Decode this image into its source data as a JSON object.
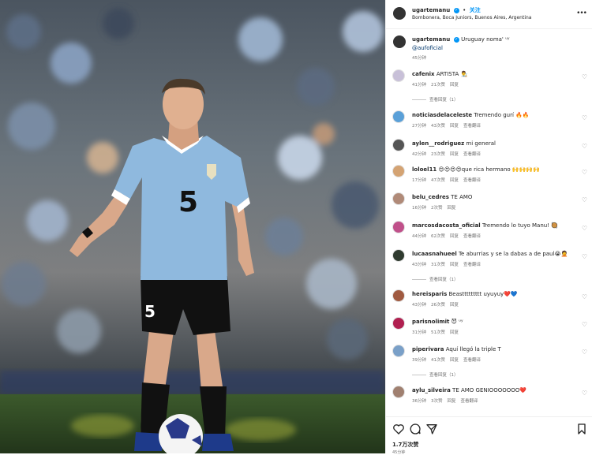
{
  "post": {
    "username": "ugartemanu",
    "follow_label": "关注",
    "location": "Bombonera, Boca Juniors, Buenos Aires, Argentina",
    "caption_text": "Uruguay noma' ᵘʸ",
    "caption_mention": "@aufoficial",
    "caption_time": "45分钟",
    "likes": "1.7万次赞",
    "post_time": "45分钟"
  },
  "player": {
    "jersey_number": "5"
  },
  "comments": [
    {
      "user": "cafenix",
      "text": "ARTISTA 👨‍🎨",
      "time": "41分钟",
      "likes": "21次赞",
      "reply": "回复",
      "translate": "",
      "replies": "查看回复（1）",
      "av_color": "#c8c0d8"
    },
    {
      "user": "noticiasdelaceleste",
      "text": "Tremendo gurí 🔥🔥",
      "time": "27分钟",
      "likes": "43次赞",
      "reply": "回复",
      "translate": "查看翻译",
      "replies": "",
      "av_color": "#5aa0d8"
    },
    {
      "user": "aylen__rodriguez",
      "text": "mi general",
      "time": "42分钟",
      "likes": "23次赞",
      "reply": "回复",
      "translate": "查看翻译",
      "replies": "",
      "av_color": "#555555"
    },
    {
      "user": "loloel11",
      "text": "😍😍😍😍que rica hermano 🙌🙌🙌🙌",
      "time": "17分钟",
      "likes": "47次赞",
      "reply": "回复",
      "translate": "查看翻译",
      "replies": "",
      "av_color": "#d4a373"
    },
    {
      "user": "belu_cedres",
      "text": "TE AMO",
      "time": "16分钟",
      "likes": "2次赞",
      "reply": "回复",
      "translate": "",
      "replies": "",
      "av_color": "#b08a78"
    },
    {
      "user": "marcosdacosta_oficial",
      "text": "Tremendo lo tuyo Manu! 🥘",
      "time": "44分钟",
      "likes": "62次赞",
      "reply": "回复",
      "translate": "查看翻译",
      "replies": "",
      "av_color": "#c0508a"
    },
    {
      "user": "lucaasnahueel",
      "text": "Te aburrias y se la dabas a de paul😭🤦",
      "time": "43分钟",
      "likes": "31次赞",
      "reply": "回复",
      "translate": "查看翻译",
      "replies": "查看回复（1）",
      "av_color": "#2f3a2f"
    },
    {
      "user": "hereisparis",
      "text": "Beasttttttttt uyuyuy❤️💙",
      "time": "43分钟",
      "likes": "26次赞",
      "reply": "回复",
      "translate": "",
      "replies": "",
      "av_color": "#a05a40"
    },
    {
      "user": "parisnolimit",
      "text": "😈 ᵘʸ",
      "time": "31分钟",
      "likes": "51次赞",
      "reply": "回复",
      "translate": "",
      "replies": "",
      "av_color": "#b02050"
    },
    {
      "user": "piperivara",
      "text": "Aquí llegó la triple T",
      "time": "39分钟",
      "likes": "41次赞",
      "reply": "回复",
      "translate": "查看翻译",
      "replies": "查看回复（1）",
      "av_color": "#7aa0c8"
    },
    {
      "user": "aylu_silveira",
      "text": "TE AMO GENIOOOOOOO❤️",
      "time": "36分钟",
      "likes": "3次赞",
      "reply": "回复",
      "translate": "查看翻译",
      "replies": "",
      "av_color": "#a08070"
    }
  ],
  "icons": {
    "like": "heart-icon",
    "comment": "comment-icon",
    "share": "share-icon",
    "save": "bookmark-icon",
    "more": "more-options-icon"
  },
  "colors": {
    "accent": "#0095f6",
    "jersey": "#8fb9de",
    "shorts": "#111111"
  }
}
